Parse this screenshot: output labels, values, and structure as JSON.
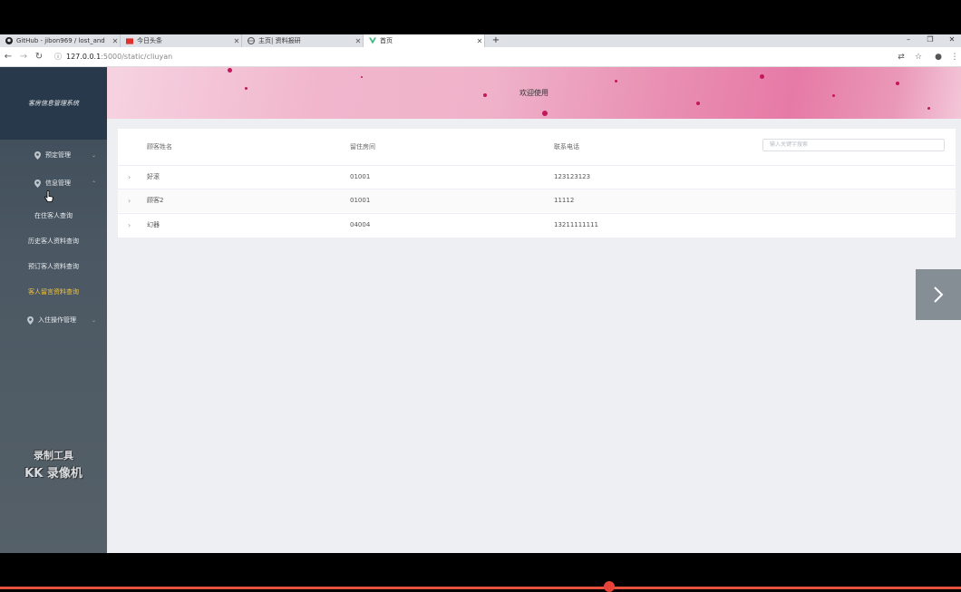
{
  "browser": {
    "tabs": [
      {
        "label": "GitHub - jibon969 / lost_and",
        "icon": "github-icon"
      },
      {
        "label": "今日头条",
        "icon": "toutiao-icon"
      },
      {
        "label": "主页| 资料报研",
        "icon": "globe-icon"
      },
      {
        "label": "首页",
        "icon": "vue-icon",
        "active": true
      }
    ],
    "url": {
      "host": "127.0.0.1",
      "path": ":5000/static/cliuyan"
    }
  },
  "sidebar": {
    "title": "客房信息管理系统",
    "menus": [
      {
        "label": "预定管理",
        "icon": "location-pin-icon"
      },
      {
        "label": "信息管理",
        "icon": "location-pin-icon",
        "children": [
          "在住客人查询",
          "历史客人资料查询",
          "预订客人资料查询",
          "客人留言资料查询"
        ]
      },
      {
        "label": "入住操作管理",
        "icon": "location-pin-icon"
      }
    ],
    "active_child": "客人留言资料查询",
    "watermark": {
      "line1": "录制工具",
      "line2": "KK 录像机"
    }
  },
  "banner": {
    "title": "欢迎使用"
  },
  "table": {
    "headers": [
      "顾客姓名",
      "留住房间",
      "联系电话"
    ],
    "search_placeholder": "输入关键字搜索",
    "rows": [
      {
        "name": "好滚",
        "room": "01001",
        "phone": "123123123"
      },
      {
        "name": "顾客2",
        "room": "01001",
        "phone": "11112"
      },
      {
        "name": "幻器",
        "room": "04004",
        "phone": "13211111111"
      }
    ]
  },
  "colors": {
    "sidebar_header": "#27394a",
    "active_menu": "#f0c23d",
    "banner_accent": "#e67aa6"
  }
}
